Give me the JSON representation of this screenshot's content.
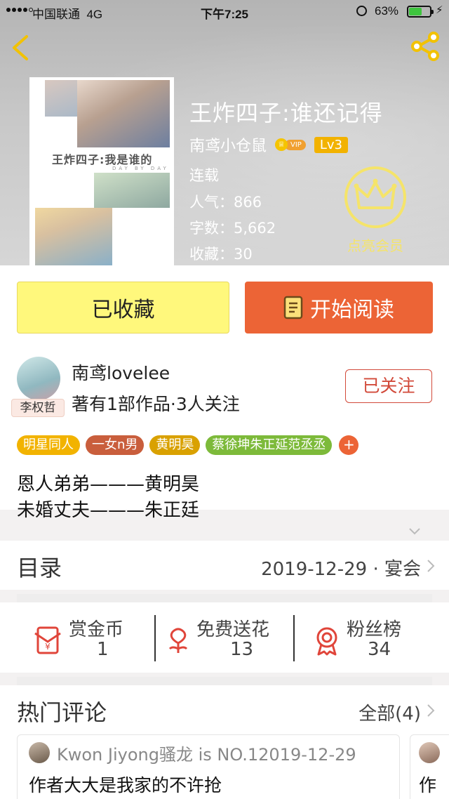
{
  "status_bar": {
    "carrier": "中国联通",
    "network": "4G",
    "time": "下午7:25",
    "battery_pct": "63%",
    "battery_level": 0.63
  },
  "book": {
    "cover_title": "王炸四子:我是谁的",
    "cover_subtitle": "DAY BY DAY",
    "title": "王炸四子:谁还记得",
    "author": "南鸢小仓鼠",
    "vip_label": "VIP",
    "level": "Lv3",
    "status": "连载",
    "popularity": "人气：866",
    "word_count": "字数：5,662",
    "favorites": "收藏：30"
  },
  "member": {
    "label": "点亮会员",
    "color": "#f5e46a"
  },
  "actions": {
    "favorite_label": "已收藏",
    "read_label": "开始阅读",
    "read_color": "#ec6436",
    "favorite_color": "#fff87c"
  },
  "author_section": {
    "name": "南鸢lovelee",
    "stats": "著有1部作品·3人关注",
    "avatar_tag": "李权哲",
    "follow_label": "已关注"
  },
  "tags": [
    {
      "label": "明星同人",
      "color": "#f2b300"
    },
    {
      "label": "一女n男",
      "color": "#c95e3c"
    },
    {
      "label": "黄明昊",
      "color": "#d9a100"
    },
    {
      "label": "蔡徐坤朱正延范丞丞",
      "color": "#7dba3a"
    }
  ],
  "intro": {
    "line1": "恩人弟弟———黄明昊",
    "line2": "未婚丈夫———朱正廷"
  },
  "toc": {
    "label": "目录",
    "latest": "2019-12-29 · 宴会"
  },
  "stats": {
    "reward": {
      "label": "赏金币",
      "value": "1"
    },
    "flowers": {
      "label": "免费送花",
      "value": "13"
    },
    "fans": {
      "label": "粉丝榜",
      "value": "34"
    }
  },
  "comments": {
    "title": "热门评论",
    "all_label": "全部(4)",
    "items": [
      {
        "user": "Kwon Jiyong骚龙 is NO.12019-12-29",
        "text": "作者大大是我家的不许抢"
      },
      {
        "text": "作"
      }
    ]
  }
}
